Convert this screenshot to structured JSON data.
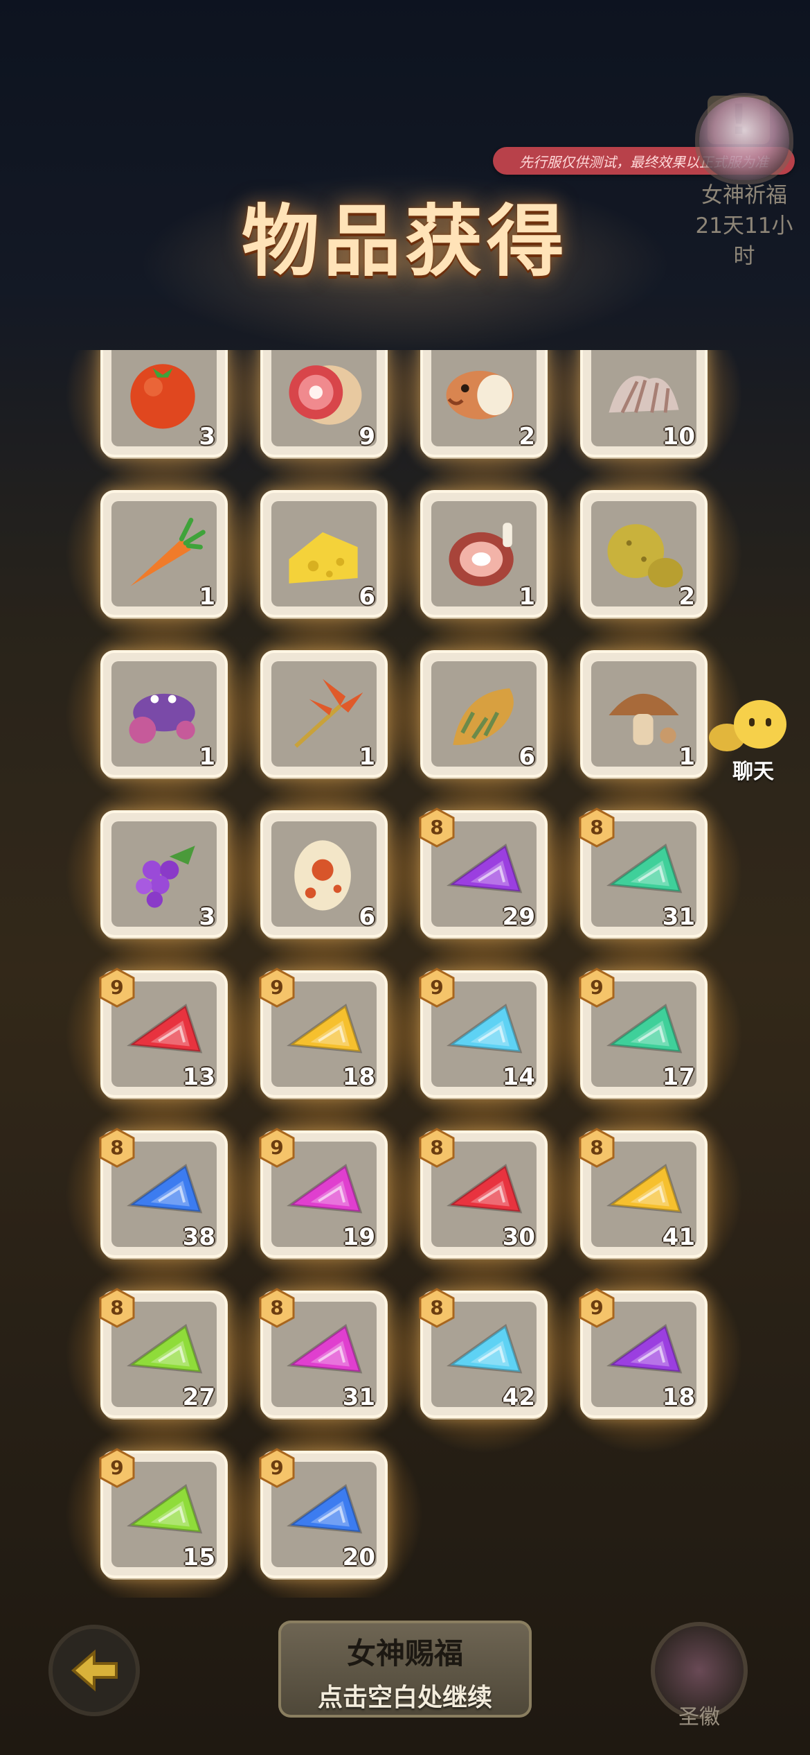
{
  "notice": "先行服仅供测试，最终效果以正式服为准",
  "title": "物品获得",
  "side_event": {
    "name": "女神祈福",
    "timer": "21天11小时"
  },
  "chat": {
    "label": "聊天"
  },
  "items": [
    {
      "icon": "tomato-icon",
      "qty": "3",
      "level": ""
    },
    {
      "icon": "ham-icon",
      "qty": "9",
      "level": ""
    },
    {
      "icon": "fish-icon",
      "qty": "2",
      "level": ""
    },
    {
      "icon": "shell-icon",
      "qty": "10",
      "level": ""
    },
    {
      "icon": "carrot-icon",
      "qty": "1",
      "level": ""
    },
    {
      "icon": "cheese-icon",
      "qty": "6",
      "level": ""
    },
    {
      "icon": "meat-leg-icon",
      "qty": "1",
      "level": ""
    },
    {
      "icon": "potato-icon",
      "qty": "2",
      "level": ""
    },
    {
      "icon": "crab-icon",
      "qty": "1",
      "level": ""
    },
    {
      "icon": "red-herb-icon",
      "qty": "1",
      "level": ""
    },
    {
      "icon": "shrimp-icon",
      "qty": "6",
      "level": ""
    },
    {
      "icon": "mushroom-icon",
      "qty": "1",
      "level": ""
    },
    {
      "icon": "grapes-icon",
      "qty": "3",
      "level": ""
    },
    {
      "icon": "egg-icon",
      "qty": "6",
      "level": ""
    },
    {
      "icon": "purple-gem-icon",
      "qty": "29",
      "level": "8"
    },
    {
      "icon": "green-gem-icon",
      "qty": "31",
      "level": "8"
    },
    {
      "icon": "red-gem-icon",
      "qty": "13",
      "level": "9"
    },
    {
      "icon": "yellow-gem-icon",
      "qty": "18",
      "level": "9"
    },
    {
      "icon": "cyan-gem-icon",
      "qty": "14",
      "level": "9"
    },
    {
      "icon": "green-gem-icon",
      "qty": "17",
      "level": "9"
    },
    {
      "icon": "blue-gem-icon",
      "qty": "38",
      "level": "8"
    },
    {
      "icon": "pink-gem-icon",
      "qty": "19",
      "level": "9"
    },
    {
      "icon": "red-gem-icon",
      "qty": "30",
      "level": "8"
    },
    {
      "icon": "yellow-gem-icon",
      "qty": "41",
      "level": "8"
    },
    {
      "icon": "lime-gem-icon",
      "qty": "27",
      "level": "8"
    },
    {
      "icon": "pink-gem-icon",
      "qty": "31",
      "level": "8"
    },
    {
      "icon": "cyan-gem-icon",
      "qty": "42",
      "level": "8"
    },
    {
      "icon": "purple-gem-icon",
      "qty": "18",
      "level": "9"
    },
    {
      "icon": "lime-gem-icon",
      "qty": "15",
      "level": "9"
    },
    {
      "icon": "blue-gem-icon",
      "qty": "20",
      "level": "9"
    }
  ],
  "gem_colors": {
    "purple-gem-icon": "#9b3fe0",
    "green-gem-icon": "#3fd09a",
    "red-gem-icon": "#e8333f",
    "yellow-gem-icon": "#f6c02e",
    "cyan-gem-icon": "#5ed2f4",
    "blue-gem-icon": "#3c7cf0",
    "pink-gem-icon": "#e03fcf",
    "lime-gem-icon": "#8fdc3a"
  },
  "bottom": {
    "blessing_label": "女神赐福",
    "continue_text": "点击空白处继续",
    "emblem_label": "圣徽"
  }
}
